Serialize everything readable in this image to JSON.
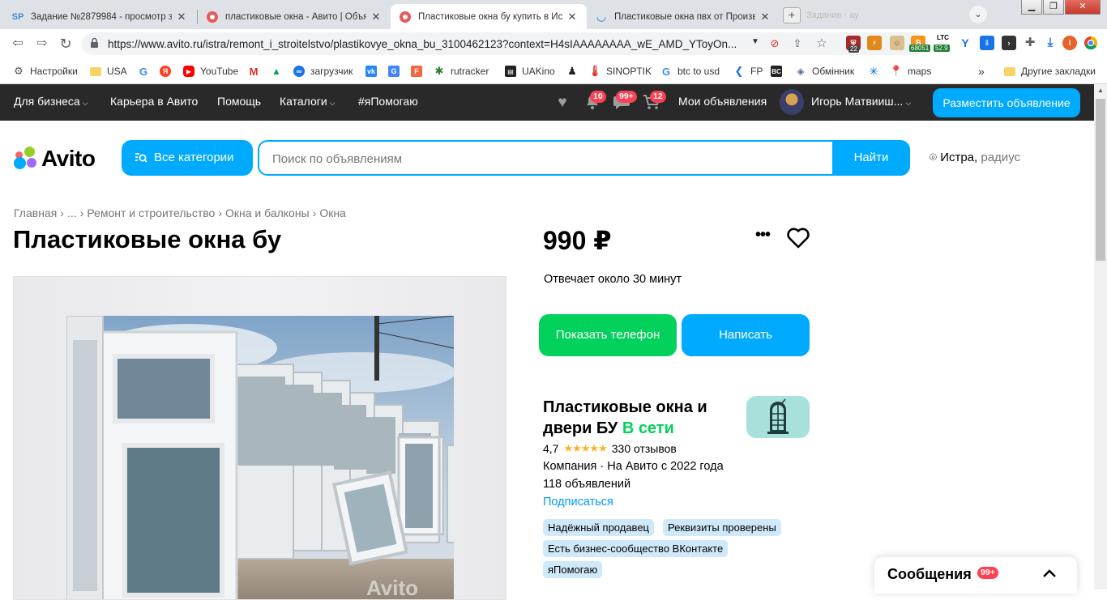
{
  "browser": {
    "tabs": [
      {
        "title": "Задание №2879984 - просмотр з",
        "favicon": "SP"
      },
      {
        "title": "пластиковые окна - Авито | Объя",
        "favicon": "avito"
      },
      {
        "title": "Пластиковые окна бу купить в Ис",
        "favicon": "avito"
      },
      {
        "title": "Пластиковые окна пвх от Произв",
        "favicon": "loading"
      }
    ],
    "ghost_tab": "Задание ⋅ ау",
    "url": "https://www.avito.ru/istra/remont_i_stroitelstvo/plastikovye_okna_bu_3100462123?context=H4sIAAAAAAAA_wE_AMD_YToyOn...",
    "extension_badges": {
      "vpn": "22",
      "btc": "68051",
      "ltc_label": "LTC",
      "ltc_value": "52.9",
      "profile": "I"
    },
    "bookmarks": [
      "Настройки",
      "USA",
      "YouTube",
      "загрузчик",
      "rutracker",
      "UAKino",
      "SINOPTIK",
      "btc to usd",
      "FP",
      "Обмінник",
      "maps"
    ],
    "other_bookmarks": "Другие закладки",
    "overflow": "»"
  },
  "header": {
    "nav": [
      "Для бизнеса",
      "Карьера в Авито",
      "Помощь",
      "Каталоги",
      "#яПомогаю"
    ],
    "badges": {
      "notifications": "10",
      "messages": "99+",
      "cart": "12"
    },
    "my_ads": "Мои объявления",
    "user_name": "Игорь Матвииш...",
    "post_ad": "Разместить объявление"
  },
  "search": {
    "logo": "Avito",
    "categories_button": "Все категории",
    "placeholder": "Поиск по объявлениям",
    "find_button": "Найти",
    "city": "Истра",
    "radius": "радиус"
  },
  "breadcrumb": [
    "Главная",
    "...",
    "Ремонт и строительство",
    "Окна и балконы",
    "Окна"
  ],
  "listing": {
    "title": "Пластиковые окна бу",
    "price": "990 ₽",
    "more": "•••",
    "reply_time": "Отвечает около 30 минут",
    "show_phone": "Показать телефон",
    "write": "Написать",
    "watermark": "Avito"
  },
  "seller": {
    "name": "Пластиковые окна и двери БУ",
    "status": "В сети",
    "rating": "4,7",
    "stars": "★★★★★",
    "reviews": "330 отзывов",
    "type_since": "Компания · На Авито с 2022 года",
    "ads_count": "118 объявлений",
    "subscribe": "Подписаться",
    "chips": [
      "Надёжный продавец",
      "Реквизиты проверены",
      "Есть бизнес-сообщество ВКонтакте",
      "яПомогаю"
    ]
  },
  "messages_panel": {
    "label": "Сообщения",
    "badge": "99+"
  },
  "colors": {
    "brand_blue": "#00aaff",
    "green": "#02d15c",
    "badge_red": "#ff4053",
    "topbar": "#292929"
  }
}
